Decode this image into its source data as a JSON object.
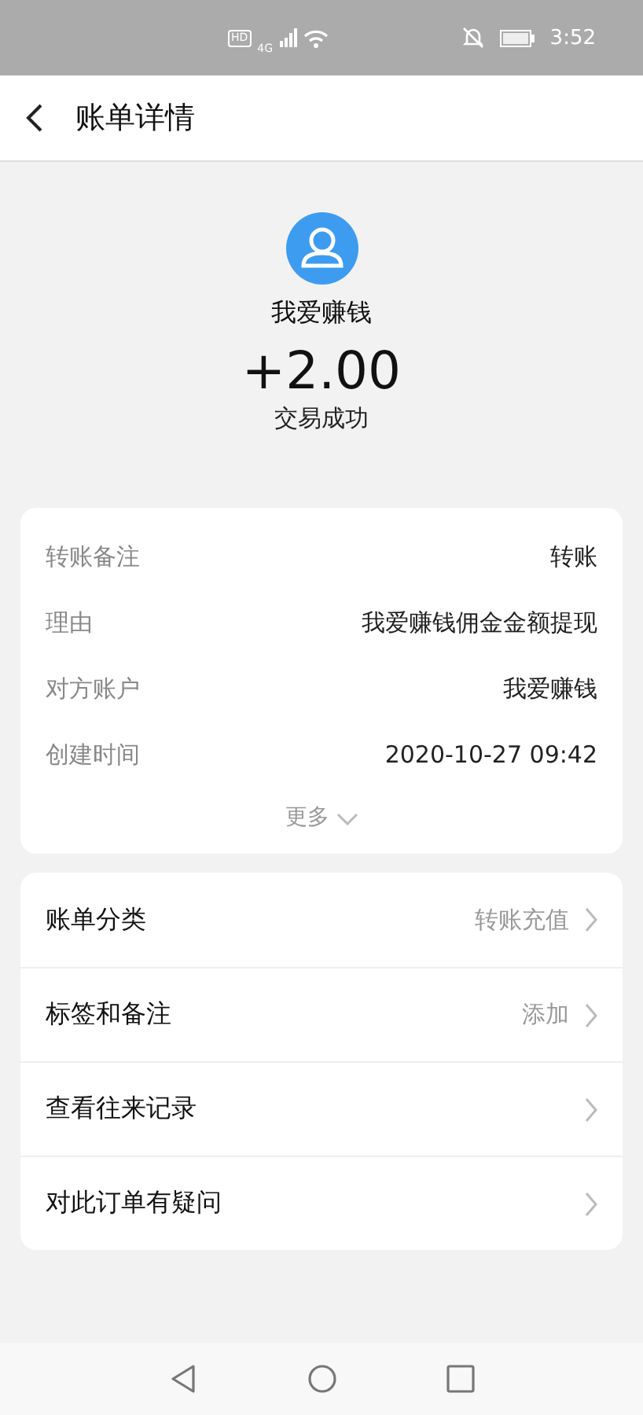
{
  "status_bar": {
    "hd_label": "HD",
    "network_label": "4G",
    "time": "3:52"
  },
  "header": {
    "title": "账单详情"
  },
  "summary": {
    "name": "我爱赚钱",
    "amount": "+2.00",
    "status": "交易成功"
  },
  "details": {
    "rows": [
      {
        "label": "转账备注",
        "value": "转账"
      },
      {
        "label": "理由",
        "value": "我爱赚钱佣金金额提现"
      },
      {
        "label": "对方账户",
        "value": "我爱赚钱"
      },
      {
        "label": "创建时间",
        "value": "2020-10-27 09:42"
      }
    ],
    "more": "更多"
  },
  "actions": [
    {
      "label": "账单分类",
      "value": "转账充值"
    },
    {
      "label": "标签和备注",
      "value": "添加"
    },
    {
      "label": "查看往来记录"
    },
    {
      "label": "对此订单有疑问"
    }
  ]
}
